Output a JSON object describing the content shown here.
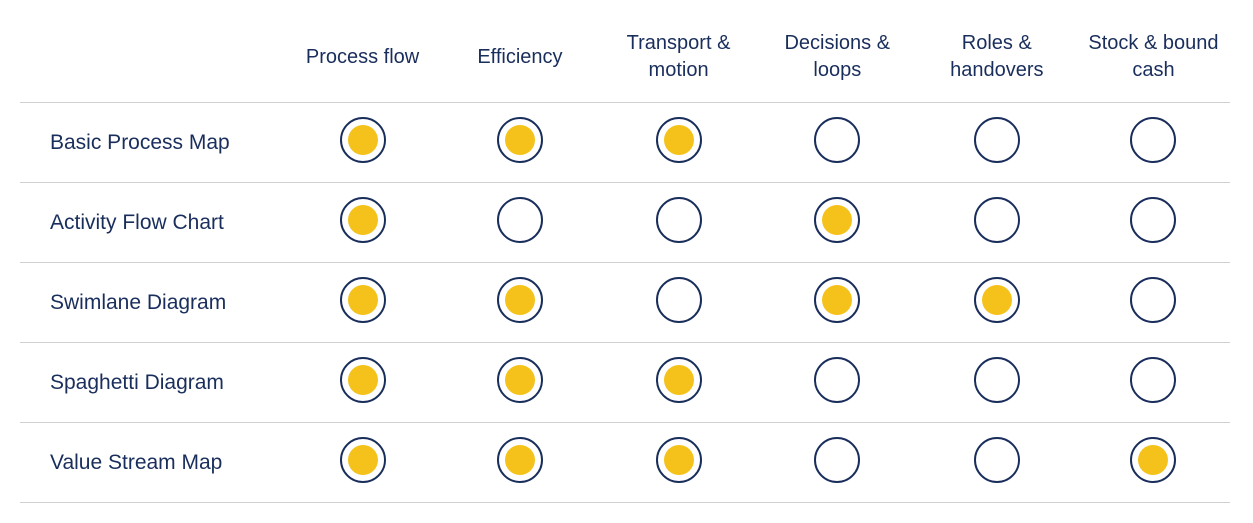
{
  "columns": [
    "Process flow",
    "Efficiency",
    "Transport & motion",
    "Decisions & loops",
    "Roles & handovers",
    "Stock & bound cash"
  ],
  "rows": [
    {
      "label": "Basic Process Map",
      "values": [
        true,
        true,
        true,
        false,
        false,
        false
      ]
    },
    {
      "label": "Activity Flow Chart",
      "values": [
        true,
        false,
        false,
        true,
        false,
        false
      ]
    },
    {
      "label": "Swimlane Diagram",
      "values": [
        true,
        true,
        false,
        true,
        true,
        false
      ]
    },
    {
      "label": "Spaghetti Diagram",
      "values": [
        true,
        true,
        true,
        false,
        false,
        false
      ]
    },
    {
      "label": "Value Stream Map",
      "values": [
        true,
        true,
        true,
        false,
        false,
        true
      ]
    }
  ],
  "colors": {
    "text": "#1a2e5c",
    "fill": "#f5c21b",
    "border": "#d0d0d0"
  }
}
